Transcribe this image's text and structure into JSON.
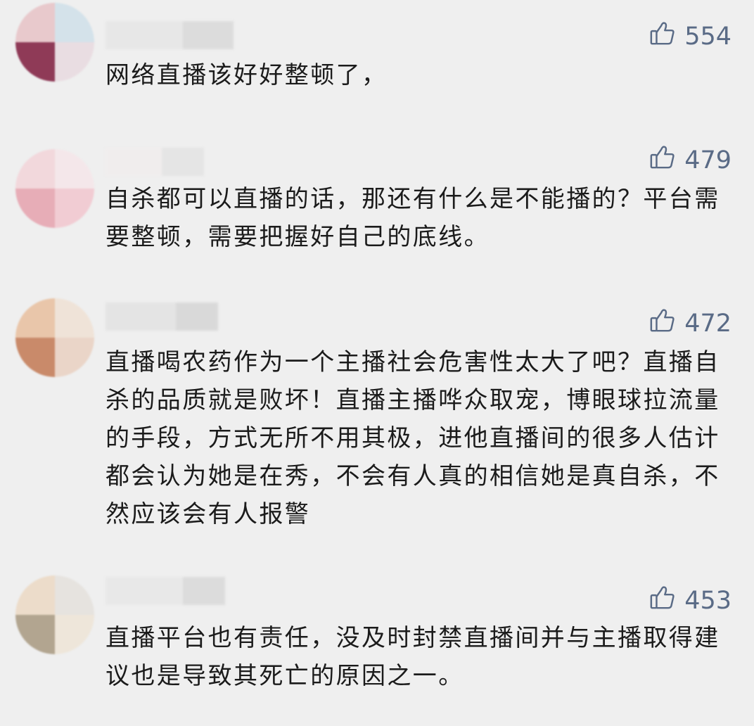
{
  "comments": [
    {
      "likes": "554",
      "text": "网络直播该好好整顿了，",
      "avatar_colors": [
        "#e8c9cc",
        "#d4e2ea",
        "#8f3a57",
        "#e9dde2"
      ]
    },
    {
      "likes": "479",
      "text": "自杀都可以直播的话，那还有什么是不能播的？平台需要整顿，需要把握好自己的底线。",
      "avatar_colors": [
        "#f2d8dc",
        "#f4e7ea",
        "#e7adb7",
        "#f1ccd3"
      ]
    },
    {
      "likes": "472",
      "text": "直播喝农药作为一个主播社会危害性太大了吧？直播自杀的品质就是败坏！直播主播哗众取宠，博眼球拉流量的手段，方式无所不用其极，进他直播间的很多人估计都会认为她是在秀，不会有人真的相信她是真自杀，不然应该会有人报警",
      "avatar_colors": [
        "#e9c6aa",
        "#efe3d8",
        "#c98a6a",
        "#ead5c8"
      ]
    },
    {
      "likes": "453",
      "text": "直播平台也有责任，没及时封禁直播间并与主播取得建议也是导致其死亡的原因之一。",
      "avatar_colors": [
        "#ecdcca",
        "#e6e3df",
        "#b2a590",
        "#eee6da"
      ]
    }
  ],
  "icons": {
    "like": "thumbs-up-icon"
  },
  "colors": {
    "background": "#efefef",
    "likes": "#5a6b86",
    "text": "#1b1b1b"
  }
}
